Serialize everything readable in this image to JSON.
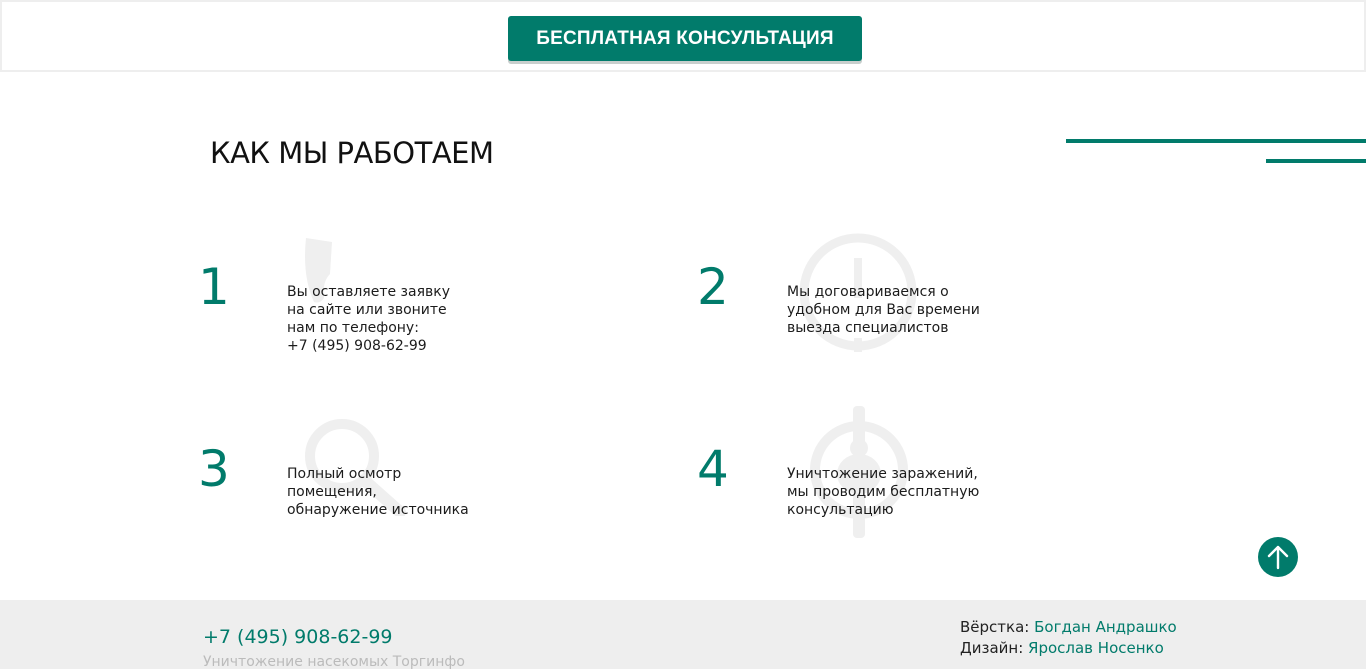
{
  "header": {
    "cta_label": "БЕСПЛАТНАЯ КОНСУЛЬТАЦИЯ"
  },
  "section": {
    "title": "КАК МЫ РАБОТАЕМ"
  },
  "steps": [
    {
      "number": "1",
      "lines": [
        "Вы оставляете заявку",
        "на сайте или звоните",
        "нам по телефону:",
        "+7 (495) 908-62-99"
      ],
      "icon": "phone-icon"
    },
    {
      "number": "2",
      "lines": [
        "Мы договариваемся о",
        "удобном для Вас времени",
        "выезда специалистов"
      ],
      "icon": "clock-icon"
    },
    {
      "number": "3",
      "lines": [
        "Полный осмотр",
        "помещения,",
        "обнаружение источника"
      ],
      "icon": "magnifier-icon"
    },
    {
      "number": "4",
      "lines": [
        "Уничтожение заражений,",
        "мы проводим бесплатную",
        "консультацию"
      ],
      "icon": "bug-target-icon"
    }
  ],
  "footer": {
    "phone": "+7 (495) 908-62-99",
    "company": "Уничтожение насекомых Торгинфо",
    "layout_label": "Вёрстка:",
    "layout_author": "Богдан Андрашко",
    "design_label": "Дизайн:",
    "design_author": "Ярослав Носенко"
  },
  "colors": {
    "accent": "#017b6b",
    "footer_bg": "#eeeeee",
    "watermark": "#efefef"
  }
}
